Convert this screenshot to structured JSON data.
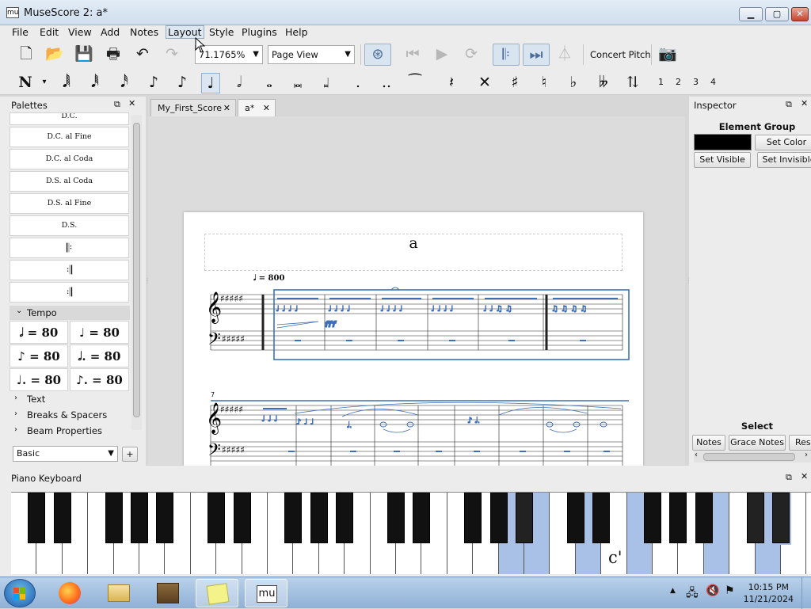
{
  "window": {
    "title": "MuseScore 2: a*",
    "logo": "mu"
  },
  "menu": [
    "File",
    "Edit",
    "View",
    "Add",
    "Notes",
    "Layout",
    "Style",
    "Plugins",
    "Help"
  ],
  "toolbar": {
    "zoom_value": "71.1765%",
    "view_mode": "Page View",
    "concert_pitch": "Concert Pitch"
  },
  "note_input": {
    "voices": [
      "1",
      "2",
      "3",
      "4"
    ]
  },
  "palettes": {
    "title": "Palettes",
    "repeat_items": [
      "D.C.",
      "D.C. al Fine",
      "D.C. al Coda",
      "D.S. al Coda",
      "D.S. al Fine",
      "D.S."
    ],
    "tempo_header": "Tempo",
    "tempo_items": [
      "= 80",
      "= 80",
      "= 80",
      "= 80",
      "= 80",
      "= 80"
    ],
    "sections": [
      "Text",
      "Breaks & Spacers",
      "Beam Properties"
    ],
    "workspace": "Basic",
    "add_button": "+"
  },
  "tabs": [
    {
      "label": "My_First_Score",
      "close": "✕"
    },
    {
      "label": "a*",
      "close": "✕"
    }
  ],
  "score": {
    "title": "a",
    "tempo_marking": "= 800",
    "system2_measure_number": "7"
  },
  "inspector": {
    "title": "Inspector",
    "section": "Element Group",
    "set_color": "Set Color",
    "set_visible": "Set Visible",
    "set_invisible": "Set Invisible",
    "select_label": "Select",
    "select_buttons": [
      "Notes",
      "Grace Notes",
      "Rest"
    ],
    "color_swatch": "#000000"
  },
  "piano": {
    "title": "Piano Keyboard",
    "key_label": "c'",
    "highlight_color": "#a9c1e6"
  },
  "taskbar": {
    "time": "10:15 PM",
    "date": "11/21/2024"
  }
}
